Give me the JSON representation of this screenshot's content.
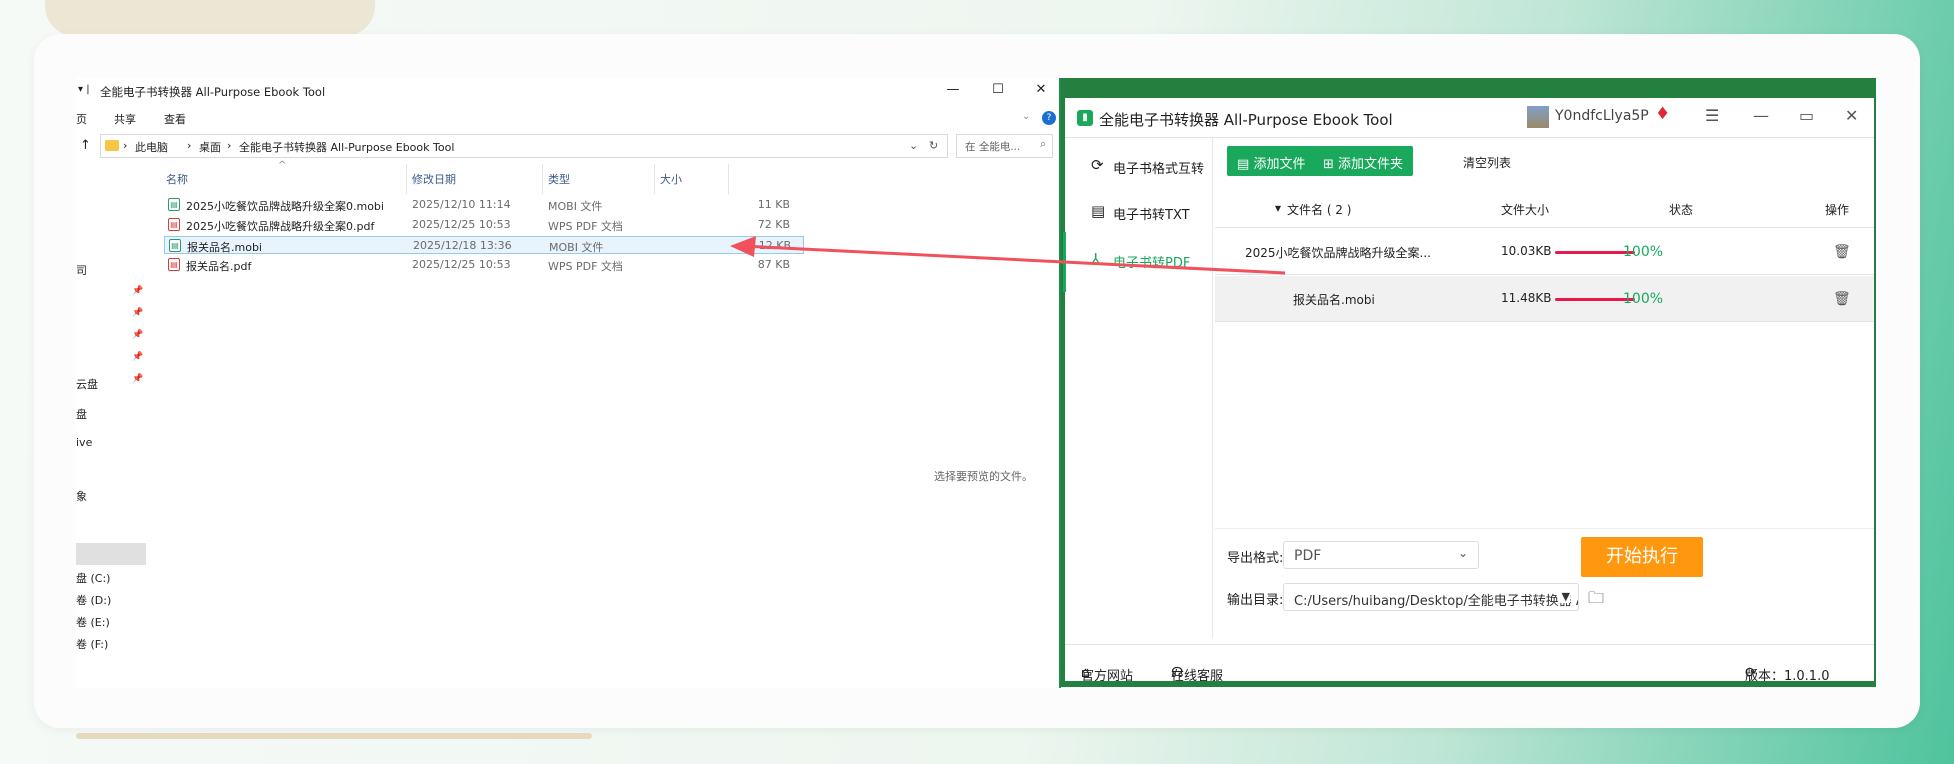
{
  "explorer": {
    "title": "全能电子书转换器 All-Purpose Ebook Tool",
    "quick_access_glyph": "▾ |",
    "window_buttons": {
      "minimize": "—",
      "maximize": "☐",
      "close": "✕"
    },
    "ribbon": [
      "页",
      "共享",
      "查看"
    ],
    "address": {
      "crumbs": [
        "›",
        "此电脑",
        "›",
        "桌面",
        "›",
        "全能电子书转换器 All-Purpose Ebook Tool"
      ],
      "search_placeholder": "在 全能电..."
    },
    "nav_items": [
      "司",
      "云盘",
      "盘",
      "ive",
      "象",
      "盘 (C:)",
      "卷 (D:)",
      "卷 (E:)",
      "卷 (F:)"
    ],
    "columns": [
      "名称",
      "修改日期",
      "类型",
      "大小"
    ],
    "files": [
      {
        "name": "2025小吃餐饮品牌战略升级全案0.mobi",
        "date": "2025/12/10 11:14",
        "type": "MOBI 文件",
        "size": "11 KB",
        "icon": "mobi-icon"
      },
      {
        "name": "2025小吃餐饮品牌战略升级全案0.pdf",
        "date": "2025/12/25 10:53",
        "type": "WPS PDF 文档",
        "size": "72 KB",
        "icon": "pdf-icon"
      },
      {
        "name": "报关品名.mobi",
        "date": "2025/12/18 13:36",
        "type": "MOBI 文件",
        "size": "12 KB",
        "icon": "mobi-icon"
      },
      {
        "name": "报关品名.pdf",
        "date": "2025/12/25 10:53",
        "type": "WPS PDF 文档",
        "size": "87 KB",
        "icon": "pdf-icon"
      }
    ],
    "preview_text": "选择要预览的文件。"
  },
  "converter": {
    "title": "全能电子书转换器 All-Purpose Ebook Tool",
    "username": "Y0ndfcLlya5P",
    "sidebar": [
      {
        "label": "电子书格式互转",
        "icon": "refresh-icon"
      },
      {
        "label": "电子书转TXT",
        "icon": "document-icon"
      },
      {
        "label": "电子书转PDF",
        "icon": "pdf-icon"
      }
    ],
    "toolbar": {
      "add_file": "添加文件",
      "add_folder": "添加文件夹",
      "clear": "清空列表"
    },
    "table": {
      "headers": [
        "文件名 ( 2 )",
        "文件大小",
        "状态",
        "操作"
      ],
      "rows": [
        {
          "name": "2025小吃餐饮品牌战略升级全案...",
          "size": "10.03KB",
          "progress": "100%"
        },
        {
          "name": "报关品名.mobi",
          "size": "11.48KB",
          "progress": "100%"
        }
      ]
    },
    "export_format_label": "导出格式:",
    "export_format_value": "PDF",
    "output_dir_label": "输出目录:",
    "output_dir_value": "C:/Users/huibang/Desktop/全能电子书转换器 All-Pu",
    "start_button": "开始执行",
    "footer": {
      "website": "官方网站",
      "support": "在线客服",
      "version": "版本：1.0.1.0"
    },
    "colors": {
      "brand_green": "#1aa85c",
      "progress_red": "#e8194a",
      "start_orange": "#ff980e"
    }
  }
}
